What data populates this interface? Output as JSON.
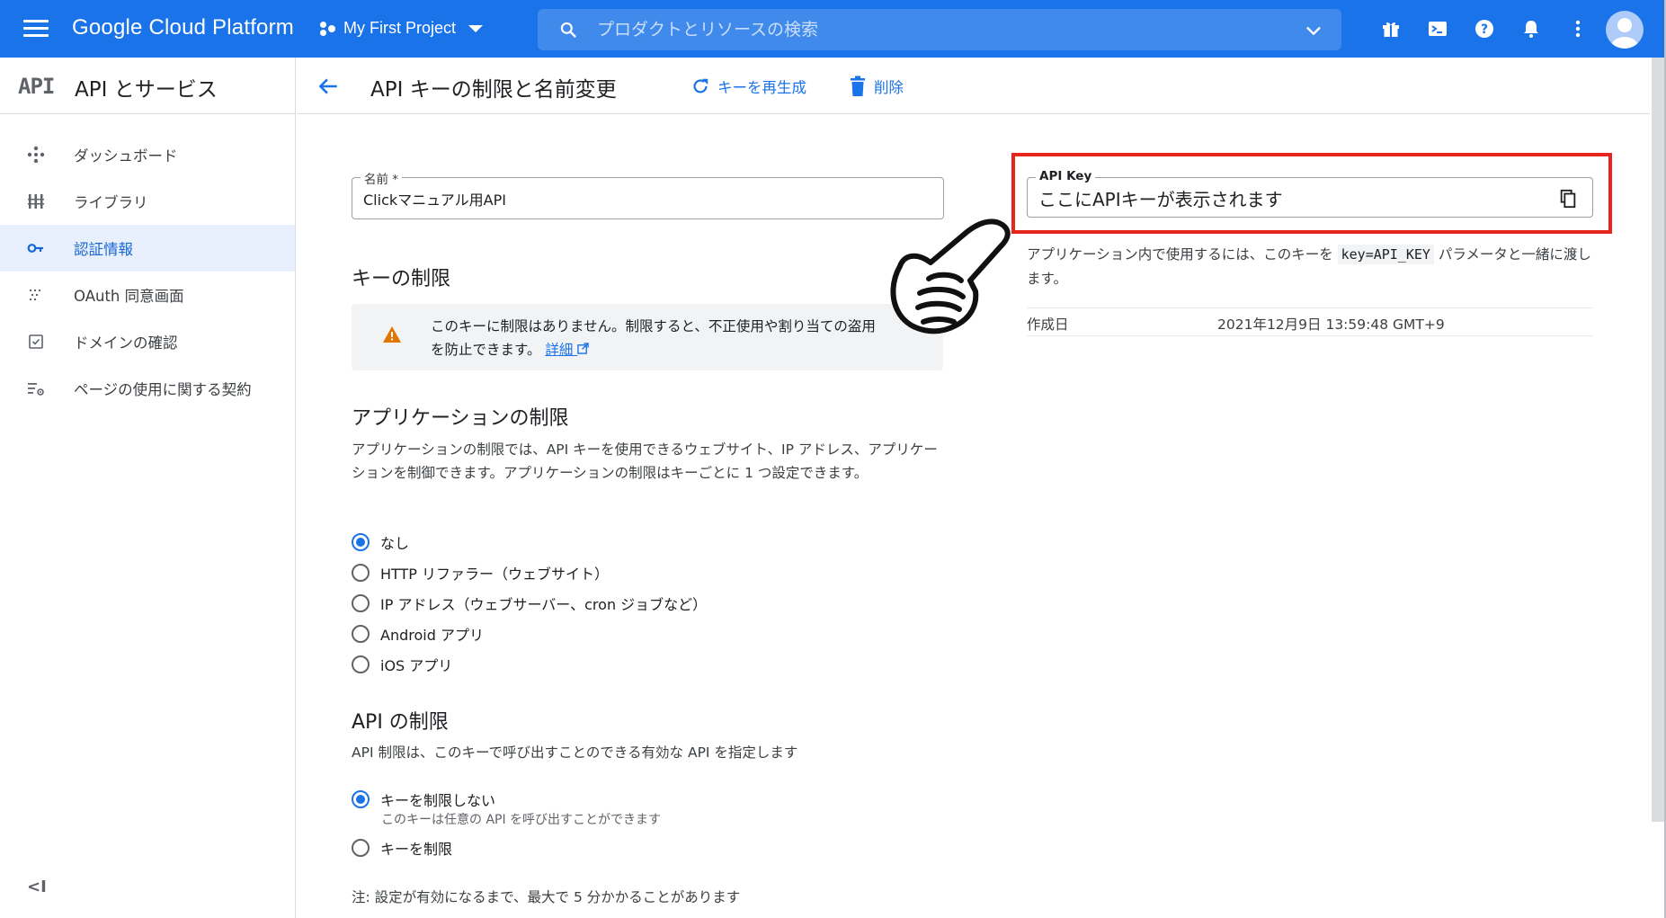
{
  "topbar": {
    "brand": "Google Cloud Platform",
    "project": "My First Project",
    "search_placeholder": "プロダクトとリソースの検索",
    "icons": [
      "gift-icon",
      "cloud-shell-icon",
      "help-icon",
      "notifications-icon",
      "more-vert-icon",
      "account-avatar"
    ]
  },
  "sidenav": {
    "logo": "API",
    "title": "API とサービス",
    "items": [
      {
        "label": "ダッシュボード",
        "icon": "dashboard-icon"
      },
      {
        "label": "ライブラリ",
        "icon": "library-icon"
      },
      {
        "label": "認証情報",
        "icon": "key-icon",
        "active": true
      },
      {
        "label": "OAuth 同意画面",
        "icon": "oauth-icon"
      },
      {
        "label": "ドメインの確認",
        "icon": "domain-check-icon"
      },
      {
        "label": "ページの使用に関する契約",
        "icon": "agreement-icon"
      }
    ],
    "collapse": "<I"
  },
  "header": {
    "title": "API キーの制限と名前変更",
    "regenerate": "キーを再生成",
    "delete": "削除"
  },
  "name_field": {
    "label": "名前 *",
    "value": "Clickマニュアル用API"
  },
  "key_restriction": {
    "heading": "キーの制限",
    "alert_text": "このキーに制限はありません。制限すると、不正使用や割り当ての盗用を防止できます。",
    "alert_link": "詳細"
  },
  "app_restriction": {
    "heading": "アプリケーションの制限",
    "description": "アプリケーションの制限では、API キーを使用できるウェブサイト、IP アドレス、アプリケーションを制御できます。アプリケーションの制限はキーごとに 1 つ設定できます。",
    "options": [
      {
        "label": "なし",
        "selected": true
      },
      {
        "label": "HTTP リファラー（ウェブサイト）",
        "selected": false
      },
      {
        "label": "IP アドレス（ウェブサーバー、cron ジョブなど）",
        "selected": false
      },
      {
        "label": "Android アプリ",
        "selected": false
      },
      {
        "label": "iOS アプリ",
        "selected": false
      }
    ]
  },
  "api_restriction": {
    "heading": "API の制限",
    "description": "API 制限は、このキーで呼び出すことのできる有効な API を指定します",
    "options": [
      {
        "label": "キーを制限しない",
        "sublabel": "このキーは任意の API を呼び出すことができます",
        "selected": true
      },
      {
        "label": "キーを制限",
        "selected": false
      }
    ]
  },
  "note": "注: 設定が有効になるまで、最大で 5 分かかることがあります",
  "api_key": {
    "label": "API Key",
    "value": "ここにAPIキーが表示されます",
    "usage_before": "アプリケーション内で使用するには、このキーを ",
    "usage_code": "key=API_KEY",
    "usage_after": " パラメータと一緒に渡します。",
    "created_label": "作成日",
    "created_value": "2021年12月9日 13:59:48 GMT+9"
  },
  "colors": {
    "primary": "#1a73e8",
    "highlight_border": "#e8251c",
    "warning": "#e37400",
    "active_nav_bg": "#e8f0fe"
  }
}
